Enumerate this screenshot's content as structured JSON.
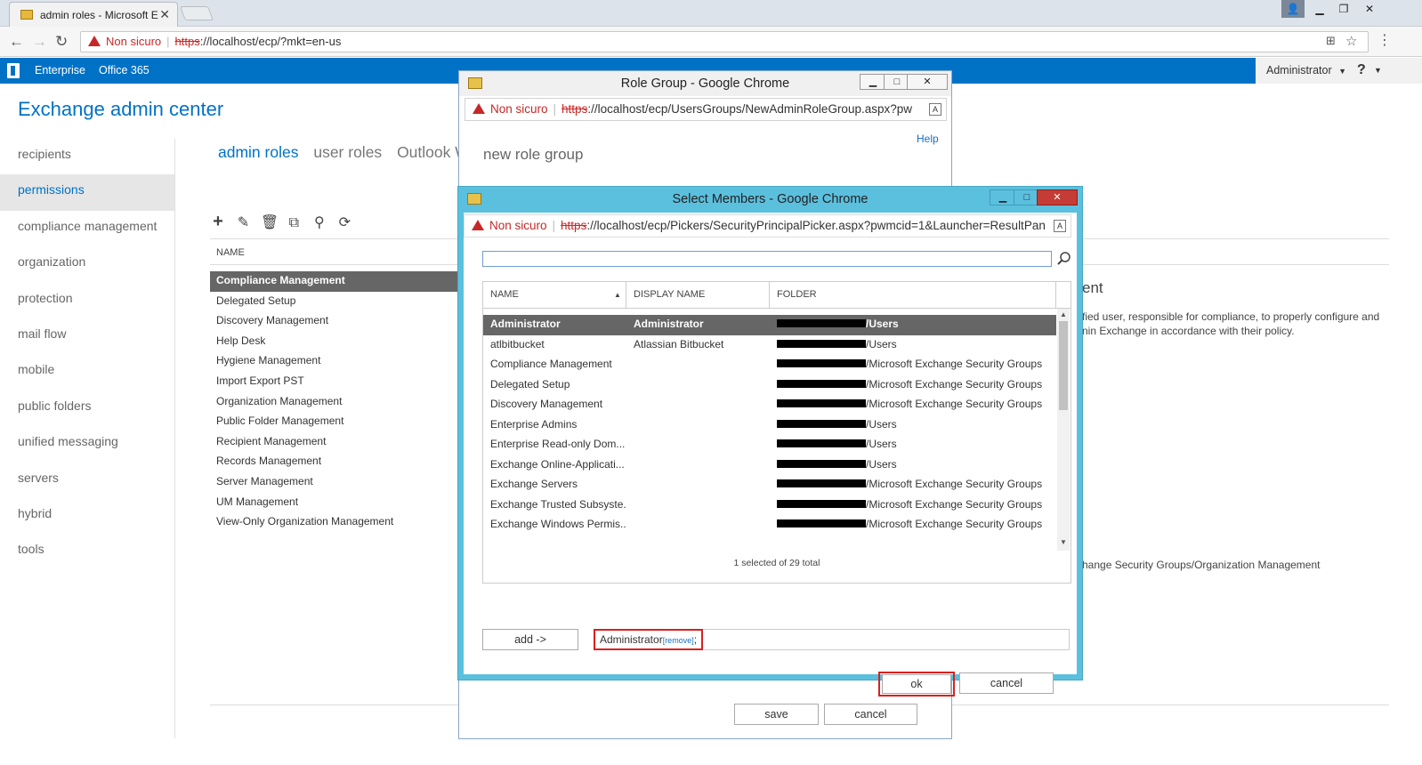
{
  "browser": {
    "tab_title": "admin roles - Microsoft E",
    "security_label": "Non sicuro",
    "url_scheme": "https",
    "url_rest": "://localhost/ecp/?mkt=en-us"
  },
  "eac": {
    "top_links": [
      "Enterprise",
      "Office 365"
    ],
    "user_menu": "Administrator",
    "help_label": "?",
    "title": "Exchange admin center",
    "nav": [
      "recipients",
      "permissions",
      "compliance management",
      "organization",
      "protection",
      "mail flow",
      "mobile",
      "public folders",
      "unified messaging",
      "servers",
      "hybrid",
      "tools"
    ],
    "nav_selected": "permissions",
    "subtabs": [
      "admin roles",
      "user roles",
      "Outlook Web App policies"
    ],
    "list_header": "NAME",
    "roles": [
      "Compliance Management",
      "Delegated Setup",
      "Discovery Management",
      "Help Desk",
      "Hygiene Management",
      "Import Export PST",
      "Organization Management",
      "Public Folder Management",
      "Recipient Management",
      "Records Management",
      "Server Management",
      "UM Management",
      "View-Only Organization Management"
    ],
    "detail": {
      "title_fragment": "ent",
      "desc_line1": "fied user, responsible for compliance, to properly configure and",
      "desc_line2": "nin Exchange in accordance with their policy.",
      "path": "hange Security Groups/Organization Management"
    }
  },
  "role_group_window": {
    "title": "Role Group - Google Chrome",
    "security_label": "Non sicuro",
    "url_scheme": "https",
    "url_rest": "://localhost/ecp/UsersGroups/NewAdminRoleGroup.aspx?pw",
    "help": "Help",
    "heading": "new role group",
    "save": "save",
    "cancel": "cancel"
  },
  "select_members_window": {
    "title": "Select Members - Google Chrome",
    "security_label": "Non sicuro",
    "url_scheme": "https",
    "url_rest": "://localhost/ecp/Pickers/SecurityPrincipalPicker.aspx?pwmcid=1&Launcher=ResultPan",
    "search_value": "",
    "columns": [
      "NAME",
      "DISPLAY NAME",
      "FOLDER"
    ],
    "rows": [
      {
        "name": "Administrator",
        "display": "Administrator",
        "folder": "/Users"
      },
      {
        "name": "atlbitbucket",
        "display": "Atlassian Bitbucket",
        "folder": "/Users"
      },
      {
        "name": "Compliance Management",
        "display": "",
        "folder": "/Microsoft Exchange Security Groups"
      },
      {
        "name": "Delegated Setup",
        "display": "",
        "folder": "/Microsoft Exchange Security Groups"
      },
      {
        "name": "Discovery Management",
        "display": "",
        "folder": "/Microsoft Exchange Security Groups"
      },
      {
        "name": "Enterprise Admins",
        "display": "",
        "folder": "/Users"
      },
      {
        "name": "Enterprise Read-only Dom...",
        "display": "",
        "folder": "/Users"
      },
      {
        "name": "Exchange Online-Applicati...",
        "display": "",
        "folder": "/Users"
      },
      {
        "name": "Exchange Servers",
        "display": "",
        "folder": "/Microsoft Exchange Security Groups"
      },
      {
        "name": "Exchange Trusted Subsyste...",
        "display": "",
        "folder": "/Microsoft Exchange Security Groups"
      },
      {
        "name": "Exchange Windows Permis...",
        "display": "",
        "folder": "/Microsoft Exchange Security Groups"
      }
    ],
    "count_text": "1 selected of 29 total",
    "add_button": "add ->",
    "selected_member": "Administrator",
    "remove_label": "[remove]",
    "selected_suffix": ";",
    "ok": "ok",
    "cancel": "cancel"
  },
  "colors": {
    "accent": "#0072c6",
    "warning": "#c62828",
    "highlight": "#d9201f",
    "picker_frame": "#5bc0de"
  }
}
